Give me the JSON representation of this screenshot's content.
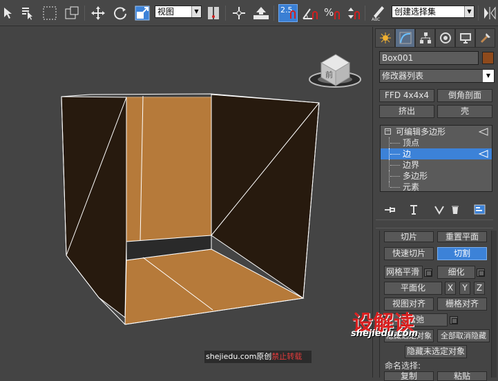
{
  "toolbar": {
    "view_select": "视图",
    "snap_value": "2.5",
    "selection_set": "创建选择集"
  },
  "viewcube": {
    "face_label": "前"
  },
  "panel": {
    "object_name": "Box001",
    "object_color": "#8e4a1c",
    "modifier_list": "修改器列表",
    "modifier_buttons": [
      "FFD 4x4x4",
      "倒角剖面",
      "挤出",
      "壳"
    ],
    "stack": {
      "root": "可编辑多边形",
      "items": [
        "顶点",
        "边",
        "边界",
        "多边形",
        "元素"
      ],
      "selected": "边"
    },
    "edit_geometry": {
      "slice": "切片",
      "reset_plane": "重置平面",
      "quick_slice": "快速切片",
      "cut": "切割",
      "meshsmooth": "网格平滑",
      "tessellate": "细化",
      "make_planar": "平面化",
      "x": "X",
      "y": "Y",
      "z": "Z",
      "view_align": "视图对齐",
      "grid_align": "栅格对齐",
      "relax": "松弛",
      "hide_selected": "隐藏选定对象",
      "unhide_all": "全部取消隐藏",
      "hide_unselected": "隐藏未选定对象",
      "named_selections": "命名选择:",
      "copy": "复制",
      "paste": "粘贴"
    },
    "accent": "#3c82d8"
  },
  "watermark": {
    "prefix": "shejiedu.com原创",
    "suffix": "禁止转载",
    "logo": "设解读",
    "url": "shejiedu.com"
  }
}
